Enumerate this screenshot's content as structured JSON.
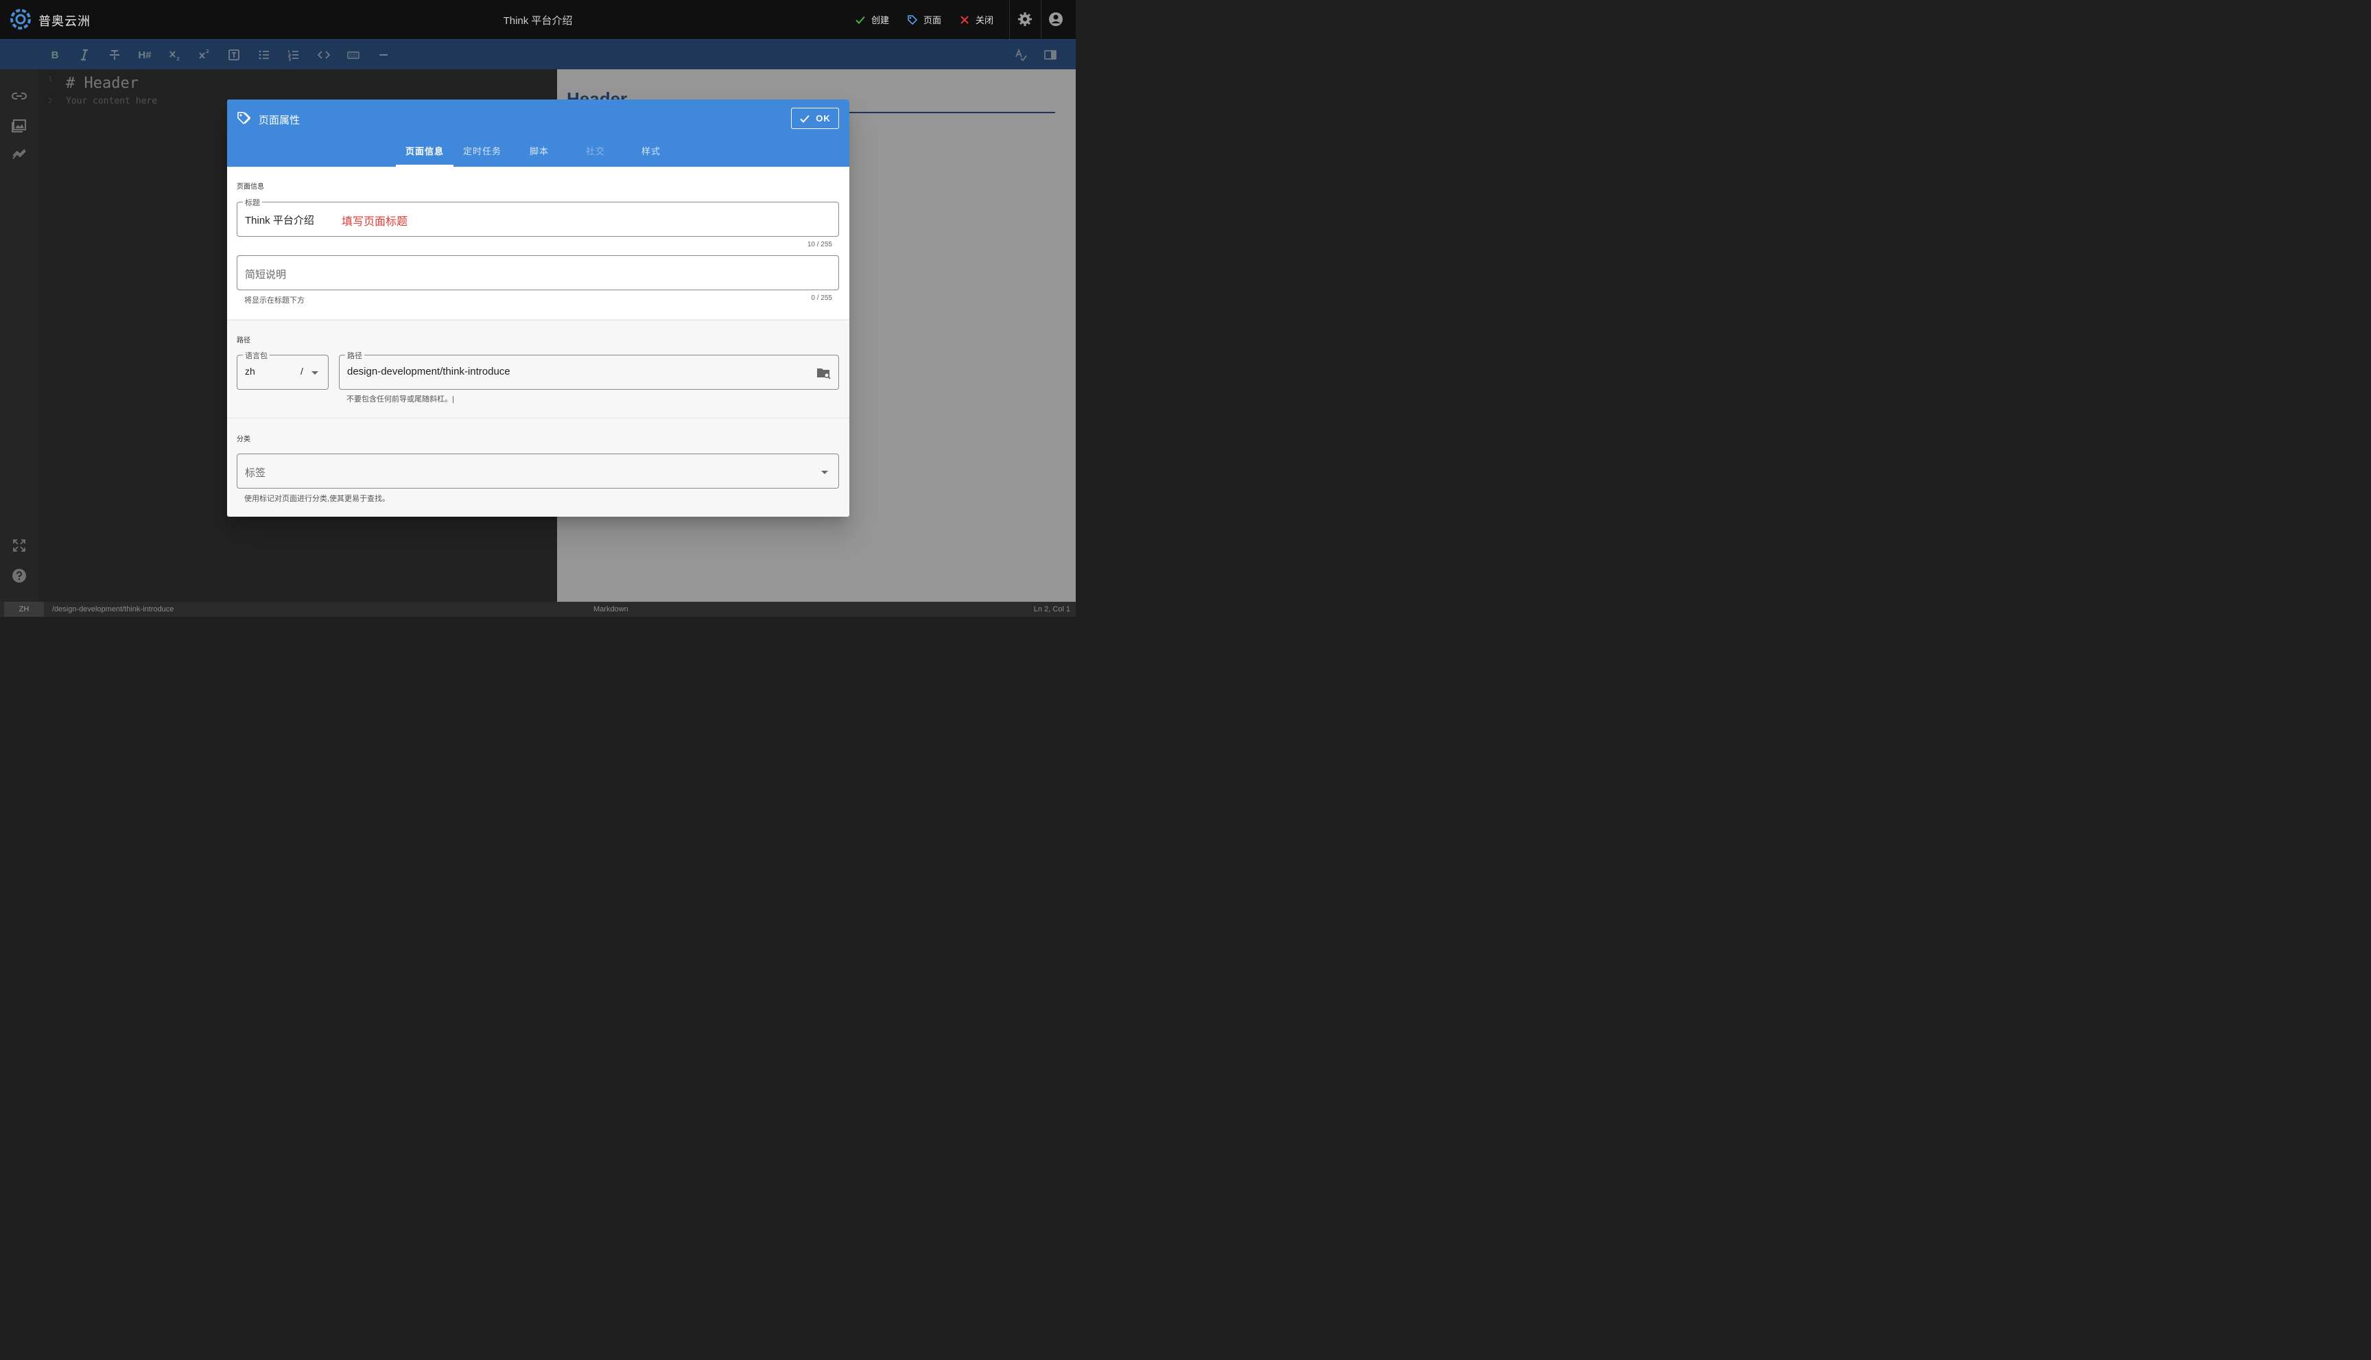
{
  "app": {
    "brand": "普奥云洲",
    "doc_title": "Think 平台介绍",
    "actions": {
      "create": "创建",
      "page": "页面",
      "close": "关闭"
    }
  },
  "toolbar": {
    "bold": "B",
    "heading": "H#"
  },
  "editor": {
    "line1_num": "1",
    "line2_num": "2",
    "line1": "# Header",
    "line2": "Your content here"
  },
  "preview": {
    "heading": "Header"
  },
  "dialog": {
    "title": "页面属性",
    "ok_label": "OK",
    "tabs": [
      "页面信息",
      "定时任务",
      "脚本",
      "社交",
      "样式"
    ],
    "section_info": "页面信息",
    "title_field": {
      "label": "标题",
      "value": "Think 平台介绍",
      "annotation": "填写页面标题",
      "counter": "10 / 255"
    },
    "desc_field": {
      "placeholder": "简短说明",
      "hint": "将显示在标题下方",
      "counter": "0 / 255"
    },
    "section_path": "路径",
    "locale_field": {
      "label": "语言包",
      "value": "zh",
      "separator": "/"
    },
    "path_field": {
      "label": "路径",
      "value": "design-development/think-introduce",
      "hint": "不要包含任何前导或尾随斜杠。|"
    },
    "section_category": "分类",
    "tags_field": {
      "placeholder": "标签",
      "hint": "使用标记对页面进行分类,使其更易于查找。"
    }
  },
  "status": {
    "lang": "ZH",
    "path": "/design-development/think-introduce",
    "mode": "Markdown",
    "position": "Ln 2, Col 1"
  },
  "colors": {
    "topbar": "#101010",
    "toolbar": "#1f4b8a",
    "dialog_header": "#3f88dc",
    "annotation": "#e53935",
    "create_check": "#4caf50",
    "close_x": "#e53935"
  }
}
